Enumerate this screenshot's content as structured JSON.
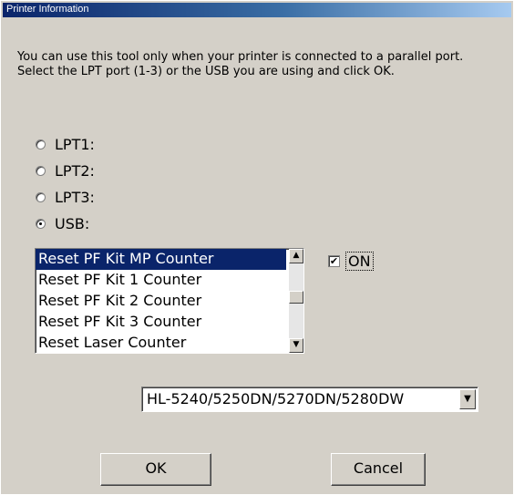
{
  "window": {
    "title": "Printer Information"
  },
  "instructions": [
    "You can use this tool only when your printer is connected to a parallel port.",
    "Select the LPT port (1-3) or the USB you are using and click OK."
  ],
  "ports": [
    {
      "label": "LPT1:",
      "selected": false
    },
    {
      "label": "LPT2:",
      "selected": false
    },
    {
      "label": "LPT3:",
      "selected": false
    },
    {
      "label": "USB:",
      "selected": true
    }
  ],
  "counters": {
    "items": [
      "Reset PF Kit MP Counter",
      "Reset PF Kit 1 Counter",
      "Reset PF Kit 2 Counter",
      "Reset PF Kit 3 Counter",
      "Reset Laser Counter"
    ],
    "selected_index": 0
  },
  "on_checkbox": {
    "label": "ON",
    "checked": true
  },
  "model_select": {
    "value": "HL-5240/5250DN/5270DN/5280DW"
  },
  "buttons": {
    "ok": "OK",
    "cancel": "Cancel"
  },
  "colors": {
    "titlebar_start": "#0a246a",
    "titlebar_end": "#a6caf0",
    "selection": "#0a246a",
    "dialog_bg": "#d4d0c8"
  }
}
